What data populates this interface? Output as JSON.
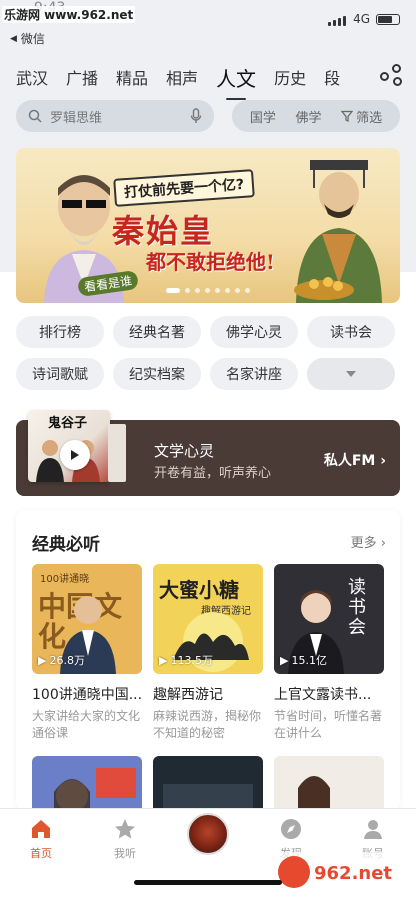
{
  "status_bar": {
    "watermark": "乐游网 www.962.net",
    "time": "9:43",
    "back_label": "微信",
    "network": "4G"
  },
  "tabs": [
    {
      "label": "武汉",
      "active": false
    },
    {
      "label": "广播",
      "active": false
    },
    {
      "label": "精品",
      "active": false
    },
    {
      "label": "相声",
      "active": false
    },
    {
      "label": "人文",
      "active": true
    },
    {
      "label": "历史",
      "active": false
    },
    {
      "label": "段",
      "active": false
    }
  ],
  "search": {
    "placeholder": "罗辑思维",
    "filters": [
      "国学",
      "佛学",
      "筛选"
    ]
  },
  "banner": {
    "subtitle": "打仗前先要一个亿?",
    "headline": "秦始皇",
    "headline2": "都不敢拒绝他!",
    "stamp": "看看是谁",
    "page_count": 8,
    "active_page": 0
  },
  "chips": [
    "排行榜",
    "经典名著",
    "佛学心灵",
    "读书会",
    "诗词歌赋",
    "纪实档案",
    "名家讲座",
    ""
  ],
  "fm_card": {
    "cover_title": "鬼谷子",
    "title": "文学心灵",
    "subtitle": "开卷有益，听声养心",
    "action": "私人FM"
  },
  "section": {
    "title": "经典必听",
    "more": "更多",
    "albums": [
      {
        "name": "100讲通晓中国...",
        "desc": "大家讲给大家的文化通俗课",
        "plays": "26.8万",
        "cover_text": "中国文化",
        "cover_tag": "100讲通晓"
      },
      {
        "name": "趣解西游记",
        "desc": "麻辣说西游，揭秘你不知道的秘密",
        "plays": "113.5万",
        "cover_text": "大蜜小糖",
        "cover_tag": "趣解西游记"
      },
      {
        "name": "上官文露读书...",
        "desc": "节省时间，听懂名著在讲什么",
        "plays": "15.1亿",
        "cover_text": "读书会",
        "cover_tag": ""
      }
    ]
  },
  "tabbar": {
    "items": [
      {
        "label": "首页",
        "active": true
      },
      {
        "label": "我听",
        "active": false
      },
      {
        "label": "发现",
        "active": false
      },
      {
        "label": "账号",
        "active": false
      }
    ]
  },
  "watermark_bottom": "962.net 乐游网",
  "colors": {
    "accent": "#e0562e",
    "fm_bg": "#4a3b36",
    "banner_red": "#c7261e",
    "header_bg": "#eef0f4"
  }
}
